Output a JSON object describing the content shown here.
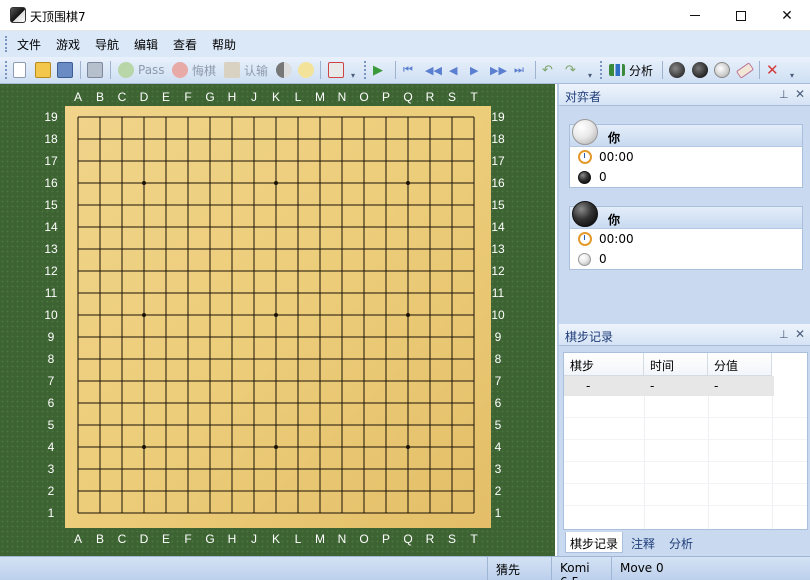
{
  "window": {
    "title": "天顶围棋7"
  },
  "menu": [
    "文件",
    "游戏",
    "导航",
    "编辑",
    "查看",
    "帮助"
  ],
  "toolbar": {
    "pass": "Pass",
    "undo": "悔棋",
    "resign": "认输",
    "analyze": "分析"
  },
  "board": {
    "size": 19,
    "columns": [
      "A",
      "B",
      "C",
      "D",
      "E",
      "F",
      "G",
      "H",
      "J",
      "K",
      "L",
      "M",
      "N",
      "O",
      "P",
      "Q",
      "R",
      "S",
      "T"
    ],
    "rows": [
      "19",
      "18",
      "17",
      "16",
      "15",
      "14",
      "13",
      "12",
      "11",
      "10",
      "9",
      "8",
      "7",
      "6",
      "5",
      "4",
      "3",
      "2",
      "1"
    ],
    "star_points": [
      "D16",
      "K16",
      "Q16",
      "D10",
      "K10",
      "Q10",
      "D4",
      "K4",
      "Q4"
    ]
  },
  "players_panel": {
    "title": "对弈者",
    "players": [
      {
        "stone": "white",
        "name": "你",
        "time": "00:00",
        "captures": "0",
        "capture_stone": "black"
      },
      {
        "stone": "black",
        "name": "你",
        "time": "00:00",
        "captures": "0",
        "capture_stone": "white"
      }
    ]
  },
  "record_panel": {
    "title": "棋步记录",
    "columns": [
      "棋步",
      "时间",
      "分值"
    ],
    "rows": [
      [
        "-",
        "-",
        "-"
      ]
    ],
    "tabs": [
      "棋步记录",
      "注释",
      "分析"
    ]
  },
  "status": {
    "mode": "猜先",
    "komi": "Komi 6.5",
    "move": "Move 0"
  },
  "colors": {
    "board_wood": "#eccd7a",
    "felt": "#3d6332",
    "panel_bg": "#c9daf0",
    "accent_title": "#1e3c78"
  }
}
